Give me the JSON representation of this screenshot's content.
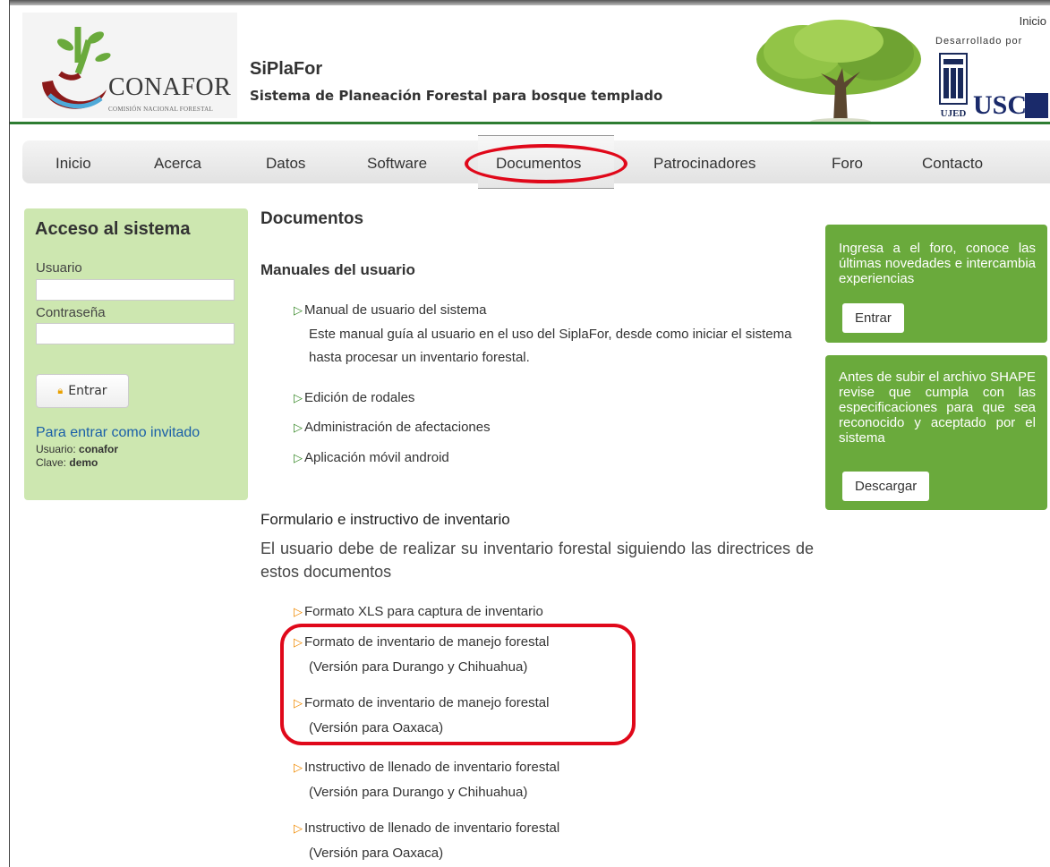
{
  "header": {
    "logo_text": "CONAFOR",
    "logo_subtext": "COMISIÓN NACIONAL FORESTAL",
    "title": "SiPlaFor",
    "subtitle": "Sistema de Planeación Forestal para bosque templado",
    "top_link": "Inicio",
    "developed_by": "Desarrollado por",
    "ujed": "UJED",
    "usc": "USC"
  },
  "nav": {
    "items": [
      "Inicio",
      "Acerca",
      "Datos",
      "Software",
      "Documentos",
      "Patrocinadores",
      "Foro",
      "Contacto"
    ],
    "active": "Documentos"
  },
  "login": {
    "title": "Acceso al sistema",
    "user_label": "Usuario",
    "password_label": "Contraseña",
    "button": "Entrar",
    "guest_link": "Para entrar como invitado",
    "guest_user_label": "Usuario:",
    "guest_user": "conafor",
    "guest_key_label": "Clave:",
    "guest_key": "demo"
  },
  "main": {
    "heading": "Documentos",
    "manuals_heading": "Manuales del usuario",
    "manual_system": "Manual de usuario del sistema",
    "manual_desc": "Este manual guía al usuario en el uso del SiplaFor, desde como iniciar el sistema hasta procesar un inventario forestal.",
    "edicion": "Edición de rodales",
    "administracion": "Administración de afectaciones",
    "movil": "Aplicación móvil android",
    "form_heading": "Formulario e instructivo de inventario",
    "form_intro": "El usuario debe de realizar su inventario forestal siguiendo las directrices de estos documentos",
    "formato_xls": "Formato XLS para captura de inventario",
    "formato_manejo": "Formato de inventario de manejo forestal",
    "version_durango": "(Versión para Durango y Chihuahua)",
    "version_oaxaca": "(Versión para Oaxaca)",
    "instructivo": "Instructivo de llenado de inventario forestal"
  },
  "sidebar_right": {
    "foro_text": "Ingresa a el foro, conoce las últimas novedades e intercambia experiencias",
    "foro_button": "Entrar",
    "shape_text": "Antes de subir el archivo SHAPE revise que cumpla con las especificaciones para que sea reconocido y aceptado por el sistema",
    "shape_button": "Descargar"
  },
  "colors": {
    "nav_highlight": "#e0081a",
    "login_bg": "#cde7b0",
    "right_box_bg": "#6aaa3c",
    "header_line": "#2e7d32"
  }
}
